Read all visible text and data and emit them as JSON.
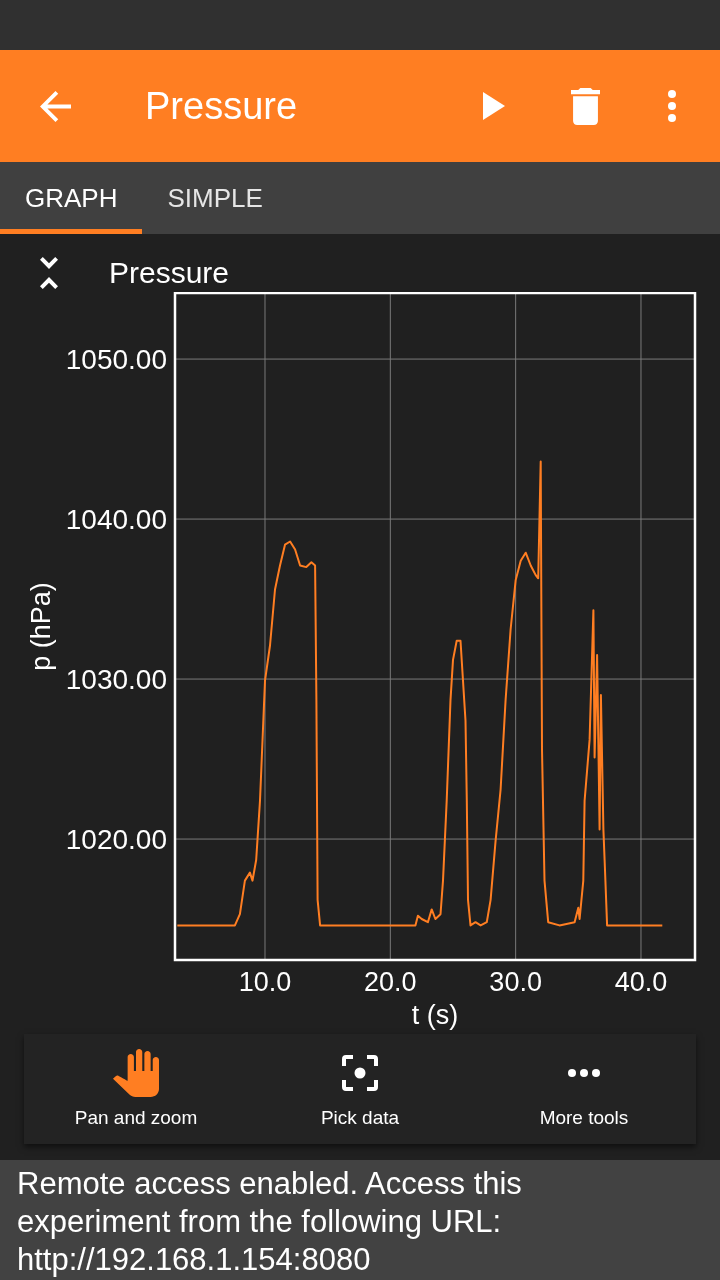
{
  "app_bar": {
    "title": "Pressure"
  },
  "tabs": [
    {
      "label": "GRAPH",
      "selected": true
    },
    {
      "label": "SIMPLE",
      "selected": false
    }
  ],
  "graph": {
    "chart_data": {
      "type": "line",
      "title": "Pressure",
      "xlabel": "t (s)",
      "ylabel": "p (hPa)",
      "grid": true,
      "xlim": [
        2.82,
        44.31
      ],
      "ylim": [
        1012.44,
        1054.13
      ],
      "xticks": [
        {
          "value": 10,
          "label": "10.0"
        },
        {
          "value": 20,
          "label": "20.0"
        },
        {
          "value": 30,
          "label": "30.0"
        },
        {
          "value": 40,
          "label": "40.0"
        }
      ],
      "yticks": [
        {
          "value": 1020,
          "label": "1020.00"
        },
        {
          "value": 1030,
          "label": "1030.00"
        },
        {
          "value": 1040,
          "label": "1040.00"
        },
        {
          "value": 1050,
          "label": "1050.00"
        }
      ],
      "x": [
        3.0,
        7.6,
        8.0,
        8.4,
        8.8,
        9.0,
        9.3,
        9.6,
        10.0,
        10.4,
        10.8,
        11.2,
        11.6,
        12.0,
        12.4,
        12.8,
        13.3,
        13.7,
        14.0,
        14.1,
        14.2,
        14.4,
        22.0,
        22.2,
        22.5,
        23.0,
        23.3,
        23.6,
        24.0,
        24.2,
        24.5,
        24.8,
        25.0,
        25.3,
        25.6,
        25.8,
        26.0,
        26.1,
        26.2,
        26.4,
        26.8,
        27.2,
        27.7,
        28.0,
        28.4,
        28.8,
        29.2,
        29.6,
        30.0,
        30.4,
        30.8,
        31.2,
        31.6,
        31.8,
        32.0,
        32.1,
        32.3,
        32.6,
        33.5,
        34.7,
        35.0,
        35.1,
        35.4,
        35.5,
        35.7,
        35.9,
        36.2,
        36.3,
        36.5,
        36.7,
        36.8,
        37.0,
        37.1,
        37.3,
        41.7
      ],
      "series": [
        {
          "color": "#ff7e22",
          "values": [
            1014.6,
            1014.6,
            1015.3,
            1017.4,
            1017.9,
            1017.4,
            1018.7,
            1022.4,
            1029.9,
            1032.1,
            1035.6,
            1037.1,
            1038.4,
            1038.6,
            1038.1,
            1037.1,
            1037.0,
            1037.3,
            1037.1,
            1028.7,
            1016.2,
            1014.6,
            1014.6,
            1015.2,
            1015.0,
            1014.8,
            1015.6,
            1015.0,
            1015.3,
            1017.4,
            1022.4,
            1028.7,
            1031.2,
            1032.4,
            1032.4,
            1029.9,
            1027.4,
            1022.4,
            1016.2,
            1014.6,
            1014.8,
            1014.6,
            1014.8,
            1016.2,
            1019.9,
            1023.1,
            1028.7,
            1033.1,
            1036.2,
            1037.4,
            1037.9,
            1037.1,
            1036.5,
            1036.3,
            1043.6,
            1025.6,
            1017.4,
            1014.8,
            1014.6,
            1014.8,
            1015.7,
            1015.0,
            1017.4,
            1022.4,
            1024.3,
            1026.2,
            1034.3,
            1025.1,
            1031.5,
            1020.6,
            1029.0,
            1020.6,
            1018.7,
            1014.6,
            1014.6
          ]
        }
      ]
    }
  },
  "tools": [
    {
      "label": "Pan and zoom",
      "selected": true
    },
    {
      "label": "Pick data",
      "selected": false
    },
    {
      "label": "More tools",
      "selected": false
    }
  ],
  "message": "Remote access enabled. Access this experiment from the following URL: http://192.168.1.154:8080"
}
